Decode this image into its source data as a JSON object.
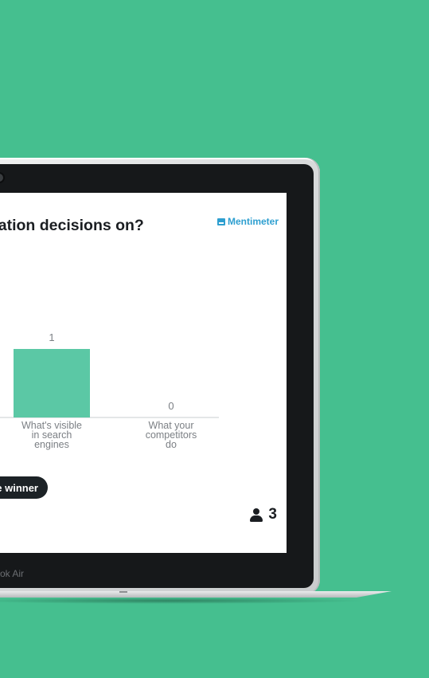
{
  "screen": {
    "question": "zation decisions on?",
    "brand": "Mentimeter",
    "winner_button": "e winner",
    "participants": "3"
  },
  "device_label": "ok Air",
  "colors": {
    "background": "#45bf8f",
    "bar": "#5bc8a5",
    "brand": "#2e9fd0",
    "button": "#1c2226"
  },
  "chart_data": {
    "type": "bar",
    "categories": [
      "What's visible in search engines",
      "What your competitors do"
    ],
    "category_lines": [
      [
        "What's visible",
        "in search",
        "engines"
      ],
      [
        "What your",
        "competitors",
        "do"
      ]
    ],
    "values": [
      1,
      0
    ],
    "value_labels": [
      "1",
      "0"
    ],
    "ylim": [
      0,
      1
    ],
    "grid": false
  }
}
